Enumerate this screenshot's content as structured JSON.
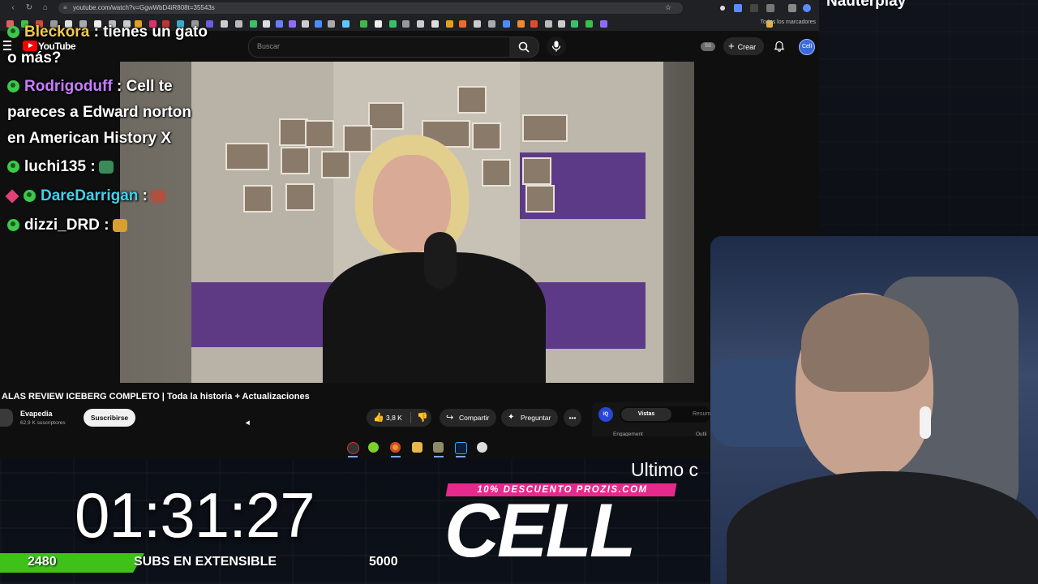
{
  "browser": {
    "url": "youtube.com/watch?v=GgwWbD4iR808t=35543s",
    "bookmarks_all": "Todos los marcadores"
  },
  "youtube": {
    "logo_text": "YouTube",
    "search_placeholder": "Buscar",
    "ss_badge": "SS",
    "create_label": "Crear",
    "avatar_text": "Cell"
  },
  "video": {
    "title": "ALAS REVIEW ICEBERG COMPLETO | Toda la historia + Actualizaciones",
    "channel_name": "Evapedia",
    "channel_subs": "62,9 K suscriptores",
    "subscribe_label": "Suscribirse",
    "likes": "3,8 K",
    "share_label": "Compartir",
    "ask_label": "Preguntar",
    "more_label": "•••"
  },
  "side_panel": {
    "iq_label": "IQ",
    "tab_active": "Vistas",
    "tab_other": "Resum",
    "engagement": "Engagement",
    "outline": "Outli"
  },
  "chat": {
    "top_partial": "Nauterplay",
    "messages": [
      {
        "user": "Bleckora",
        "user_color": "#f2c94c",
        "text": ": tienes un gato o más?"
      },
      {
        "user": "Rodrigoduff",
        "user_color": "#c77dff",
        "text": ": Cell te pareces a Edward norton en American History X"
      },
      {
        "user": "luchi135",
        "user_color": "#ffffff",
        "text": ":"
      },
      {
        "user": "DareDarrigan",
        "user_color": "#3fd2f0",
        "text": ":"
      },
      {
        "user": "dizzi_DRD",
        "user_color": "#ffffff",
        "text": ":"
      }
    ]
  },
  "overlay": {
    "timer": "01:31:27",
    "subs_current": "2480",
    "subs_label": "SUBS EN EXTENSIBLE",
    "subs_goal": "5000",
    "subs_progress": 0.496,
    "ticker": "Ultimo c",
    "promo": "10% DESCUENTO PROZIS.COM",
    "brand": "CELL"
  },
  "colors": {
    "accent_green": "#3ec21a",
    "promo_pink": "#e62a8c",
    "youtube_red": "#ff0000"
  }
}
